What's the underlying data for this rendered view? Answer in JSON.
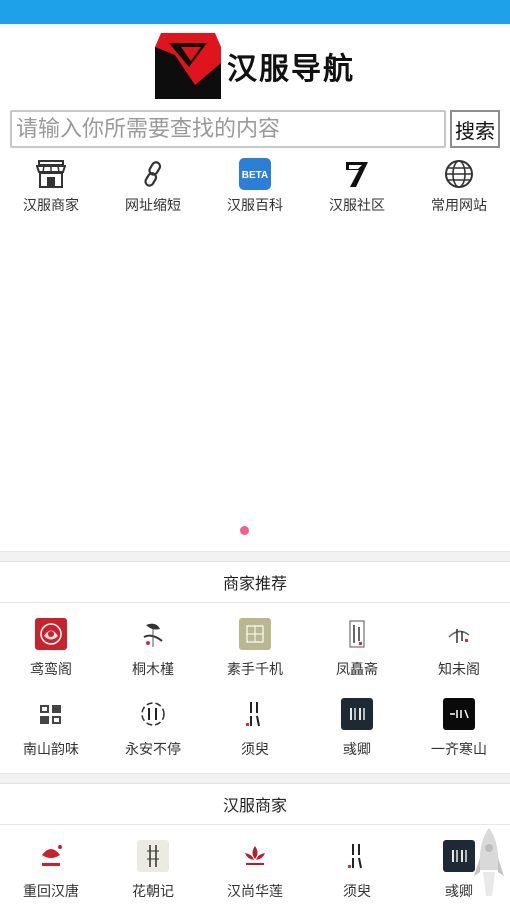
{
  "app": {
    "title": "汉服导航"
  },
  "search": {
    "placeholder": "请输入你所需要查找的内容",
    "button_label": "搜索"
  },
  "nav": [
    {
      "label": "汉服商家",
      "icon": "shop-icon"
    },
    {
      "label": "网址缩短",
      "icon": "link-icon"
    },
    {
      "label": "汉服百科",
      "icon": "beta-icon",
      "badge": "BETA"
    },
    {
      "label": "汉服社区",
      "icon": "community-logo-icon"
    },
    {
      "label": "常用网站",
      "icon": "globe-icon"
    }
  ],
  "banner": {
    "page_indicator_count": 1,
    "active_color": "#ef5f8e"
  },
  "merchant_recommend": {
    "title": "商家推荐",
    "items": [
      {
        "label": "鸢鸾阁",
        "icon": "yuanluange-logo"
      },
      {
        "label": "桐木槿",
        "icon": "tongmujin-logo"
      },
      {
        "label": "素手千机",
        "icon": "sushouqianji-logo"
      },
      {
        "label": "凤矗斋",
        "icon": "fengchuzhai-logo"
      },
      {
        "label": "知未阁",
        "icon": "zhiweige-logo"
      },
      {
        "label": "南山韵味",
        "icon": "nanshanyunwei-logo"
      },
      {
        "label": "永安不停",
        "icon": "yonganbuting-logo"
      },
      {
        "label": "须臾",
        "icon": "xuyu-logo"
      },
      {
        "label": "彧卿",
        "icon": "yuqing-logo"
      },
      {
        "label": "一齐寒山",
        "icon": "yiqihanshan-logo"
      }
    ]
  },
  "hanfu_merchants": {
    "title": "汉服商家",
    "items": [
      {
        "label": "重回汉唐",
        "icon": "chonghuihantang-logo"
      },
      {
        "label": "花朝记",
        "icon": "huazhaoji-logo"
      },
      {
        "label": "汉尚华莲",
        "icon": "hanshanghualian-logo"
      },
      {
        "label": "须臾",
        "icon": "xuyu-logo"
      },
      {
        "label": "彧卿",
        "icon": "yuqing-logo"
      }
    ]
  },
  "colors": {
    "status_bar": "#1ea1e8",
    "logo_red": "#e0141c",
    "accent_dot": "#ef5f8e"
  }
}
